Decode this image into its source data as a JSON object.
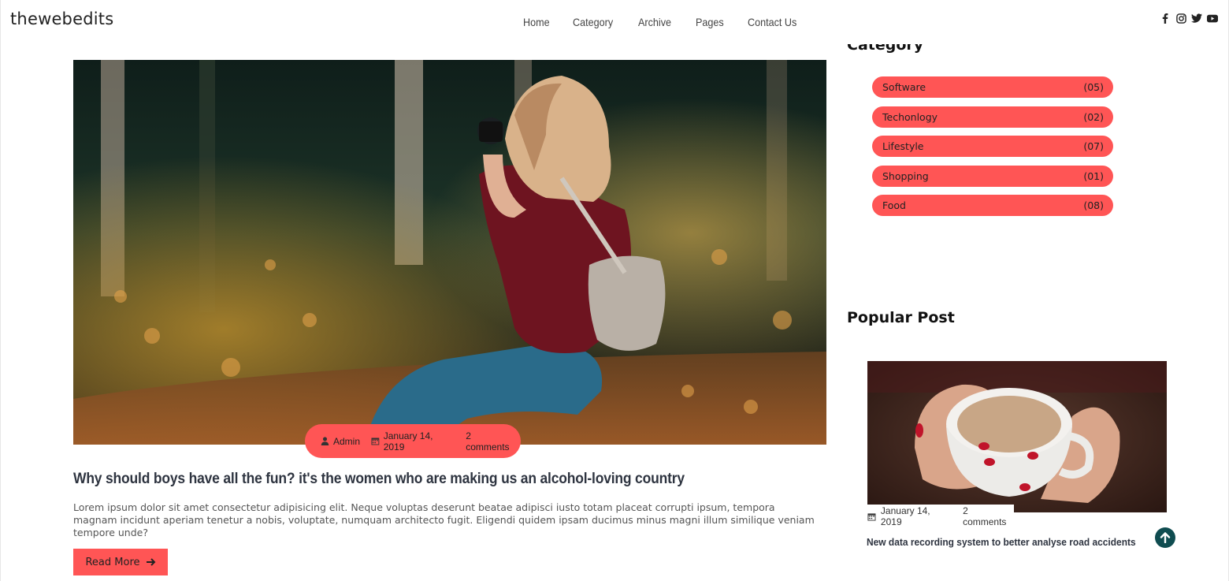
{
  "site": {
    "brand": "thewebedits"
  },
  "nav": {
    "items": [
      "Home",
      "Category",
      "Archive",
      "Pages",
      "Contact Us"
    ]
  },
  "social": {
    "icons": [
      "facebook-icon",
      "instagram-icon",
      "twitter-icon",
      "youtube-icon"
    ]
  },
  "article": {
    "author": "Admin",
    "date": "January 14, 2019",
    "comments": "2 comments",
    "title": "Why should boys have all the fun? it's the women who are making us an alcohol-loving country",
    "excerpt": "Lorem ipsum dolor sit amet consectetur adipisicing elit. Neque voluptas deserunt beatae adipisci iusto totam placeat corrupti ipsum, tempora magnam incidunt aperiam tenetur a nobis, voluptate, numquam architecto fugit. Eligendi quidem ipsam ducimus minus magni illum similique veniam tempore unde?",
    "read_more": "Read More"
  },
  "sidebar": {
    "category_heading": "Category",
    "categories": [
      {
        "name": "Software",
        "count": "(05)"
      },
      {
        "name": "Techonlogy",
        "count": "(02)"
      },
      {
        "name": "Lifestyle",
        "count": "(07)"
      },
      {
        "name": "Shopping",
        "count": "(01)"
      },
      {
        "name": "Food",
        "count": "(08)"
      }
    ],
    "popular_heading": "Popular Post",
    "popular": {
      "date": "January 14, 2019",
      "comments": "2 comments",
      "title": "New data recording system to better analyse road accidents"
    }
  },
  "colors": {
    "accent": "#ff5555",
    "scroll_button": "#0f4c50"
  }
}
